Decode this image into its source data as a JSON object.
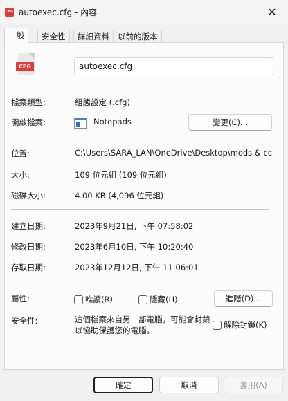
{
  "window": {
    "title": "autoexec.cfg - 內容",
    "title_icon_text": "CFG",
    "close_glyph": "✕"
  },
  "tabs": [
    {
      "label": "一般",
      "active": true
    },
    {
      "label": "安全性",
      "active": false
    },
    {
      "label": "詳細資料",
      "active": false
    },
    {
      "label": "以前的版本",
      "active": false
    }
  ],
  "general": {
    "file_icon_text": "CFG",
    "file_name": "autoexec.cfg",
    "type_label": "檔案類型:",
    "type_value": "組態設定 (.cfg)",
    "opens_with_label": "開啟檔案:",
    "opens_with_value": "Notepads",
    "change_button": "變更(C)...",
    "location_label": "位置:",
    "location_value": "C:\\Users\\SARA_LAN\\OneDrive\\Desktop\\mods & cc",
    "size_label": "大小:",
    "size_value": "109 位元組 (109 位元組)",
    "disk_size_label": "磁碟大小:",
    "disk_size_value": "4.00 KB (4,096 位元組)",
    "created_label": "建立日期:",
    "created_value": "2023年9月21日, 下午 07:58:02",
    "modified_label": "修改日期:",
    "modified_value": "2023年6月10日, 下午 10:20:40",
    "accessed_label": "存取日期:",
    "accessed_value": "2023年12月12日, 下午 11:06:01",
    "attributes_label": "屬性:",
    "readonly_label": "唯讀(R)",
    "readonly_checked": false,
    "hidden_label": "隱藏(H)",
    "hidden_checked": false,
    "advanced_button": "進階(D)...",
    "security_label": "安全性:",
    "security_text": "這個檔案來自另一部電腦，可能會封鎖以協助保護您的電腦。",
    "unblock_label": "解除封鎖(K)",
    "unblock_checked": false
  },
  "footer": {
    "ok": "確定",
    "cancel": "取消",
    "apply": "套用(A)",
    "apply_enabled": false
  }
}
